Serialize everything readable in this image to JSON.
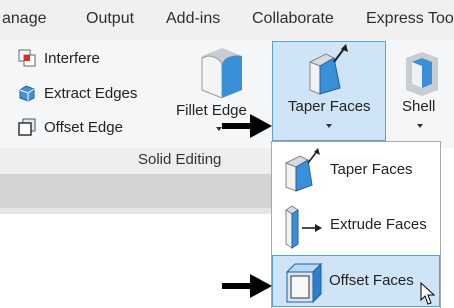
{
  "menu": {
    "tabs": [
      "anage",
      "Output",
      "Add-ins",
      "Collaborate",
      "Express Too"
    ]
  },
  "ribbon": {
    "small_buttons": [
      {
        "label": "Interfere",
        "icon": "interfere-icon"
      },
      {
        "label": "Extract Edges",
        "icon": "extract-edges-icon"
      },
      {
        "label": "Offset Edge",
        "icon": "offset-edge-icon"
      }
    ],
    "fillet_edge": "Fillet Edge",
    "taper_faces": "Taper Faces",
    "shell": "Shell",
    "panel_title": "Solid Editing"
  },
  "dropdown": {
    "items": [
      {
        "label": "Taper Faces",
        "icon": "taper-faces-icon"
      },
      {
        "label": "Extrude Faces",
        "icon": "extrude-faces-icon"
      },
      {
        "label": "Offset Faces",
        "icon": "offset-faces-icon",
        "highlighted": true
      }
    ]
  },
  "colors": {
    "highlight_fill": "#cfe4f7",
    "highlight_border": "#5a9fd8",
    "ribbon_bg": "#f5f6f7"
  }
}
